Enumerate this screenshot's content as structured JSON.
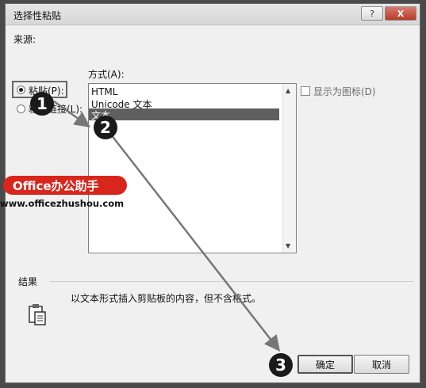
{
  "dialog": {
    "title": "选择性粘贴",
    "help_label": "?",
    "close_label": "X"
  },
  "source": {
    "label": "来源:"
  },
  "method": {
    "label": "方式(A):",
    "options": [
      {
        "label": "粘贴(P):",
        "checked": true
      },
      {
        "label": "粘贴链接(L):",
        "checked": false
      }
    ]
  },
  "list": {
    "items": [
      "HTML",
      "Unicode 文本",
      "文本"
    ],
    "selected_index": 2
  },
  "show_as_icon": {
    "label": "显示为图标(D)",
    "checked": false
  },
  "result": {
    "label": "结果",
    "text": "以文本形式插入剪贴板的内容，但不含格式。",
    "icon": "clipboard-icon"
  },
  "buttons": {
    "ok": "确定",
    "cancel": "取消"
  },
  "annotations": {
    "step1": "1",
    "step2": "2",
    "step3": "3"
  },
  "watermark": {
    "brand": "Office办公助手",
    "url": "www.officezhushou.com"
  },
  "colors": {
    "selection": "#5f5f5f",
    "watermark_red": "#d8261c"
  }
}
